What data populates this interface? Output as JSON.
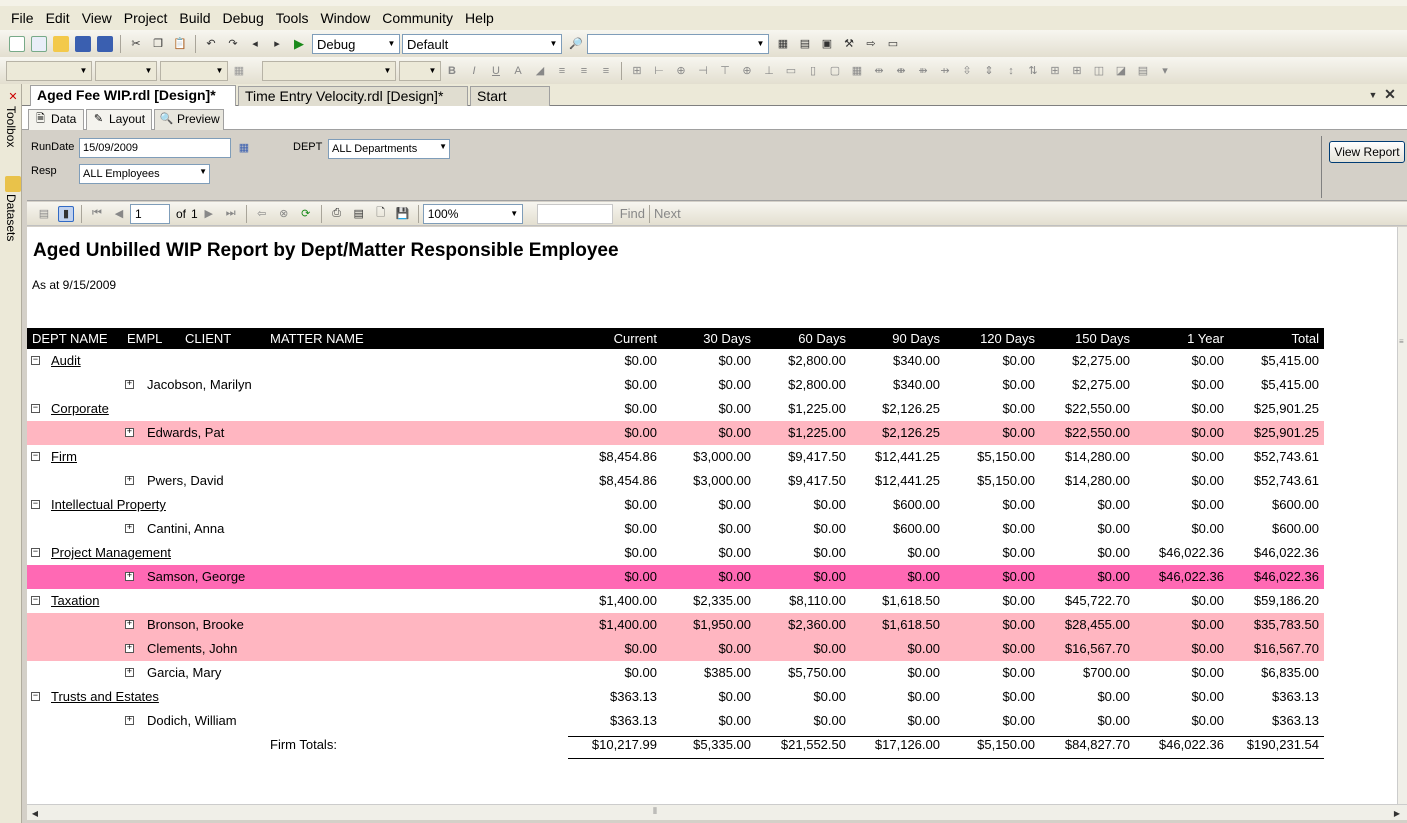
{
  "menu": [
    "File",
    "Edit",
    "View",
    "Project",
    "Build",
    "Debug",
    "Tools",
    "Window",
    "Community",
    "Help"
  ],
  "toolbar": {
    "config": "Debug",
    "platform": "Default"
  },
  "side_tabs": {
    "toolbox": "Toolbox",
    "datasets": "Datasets"
  },
  "doc_tabs": [
    "Aged Fee WIP.rdl [Design]*",
    "Time Entry Velocity.rdl [Design]*",
    "Start Page"
  ],
  "view_tabs": [
    "Data",
    "Layout",
    "Preview"
  ],
  "params": {
    "rundate_label": "RunDate",
    "rundate_value": "15/09/2009",
    "dept_label": "DEPT",
    "dept_value": "ALL Departments",
    "resp_label": "Resp",
    "resp_value": "ALL Employees",
    "view_button": "View Report"
  },
  "report_toolbar": {
    "page": "1",
    "of_label": "of",
    "total_pages": "1",
    "zoom": "100%",
    "find": "Find",
    "next": "Next"
  },
  "report": {
    "title": "Aged Unbilled WIP Report by Dept/Matter Responsible Employee",
    "subtitle": "As at 9/15/2009",
    "columns": [
      "DEPT NAME",
      "EMPL",
      "CLIENT",
      "MATTER NAME",
      "Current",
      "30 Days",
      "60 Days",
      "90 Days",
      "120 Days",
      "150 Days",
      "1 Year",
      "Total"
    ],
    "rows": [
      {
        "kind": "dept",
        "name": "Audit",
        "values": [
          "$0.00",
          "$0.00",
          "$2,800.00",
          "$340.00",
          "$0.00",
          "$2,275.00",
          "$0.00",
          "$5,415.00"
        ],
        "bg": "#ffffff"
      },
      {
        "kind": "emp",
        "name": "Jacobson, Marilyn",
        "values": [
          "$0.00",
          "$0.00",
          "$2,800.00",
          "$340.00",
          "$0.00",
          "$2,275.00",
          "$0.00",
          "$5,415.00"
        ],
        "bg": "#ffffff"
      },
      {
        "kind": "dept",
        "name": "Corporate",
        "values": [
          "$0.00",
          "$0.00",
          "$1,225.00",
          "$2,126.25",
          "$0.00",
          "$22,550.00",
          "$0.00",
          "$25,901.25"
        ],
        "bg": "#ffffff"
      },
      {
        "kind": "emp",
        "name": "Edwards, Pat",
        "values": [
          "$0.00",
          "$0.00",
          "$1,225.00",
          "$2,126.25",
          "$0.00",
          "$22,550.00",
          "$0.00",
          "$25,901.25"
        ],
        "bg": "#ffb6c1"
      },
      {
        "kind": "dept",
        "name": "Firm",
        "values": [
          "$8,454.86",
          "$3,000.00",
          "$9,417.50",
          "$12,441.25",
          "$5,150.00",
          "$14,280.00",
          "$0.00",
          "$52,743.61"
        ],
        "bg": "#ffffff"
      },
      {
        "kind": "emp",
        "name": "Pwers, David",
        "values": [
          "$8,454.86",
          "$3,000.00",
          "$9,417.50",
          "$12,441.25",
          "$5,150.00",
          "$14,280.00",
          "$0.00",
          "$52,743.61"
        ],
        "bg": "#ffffff"
      },
      {
        "kind": "dept",
        "name": "Intellectual Property",
        "values": [
          "$0.00",
          "$0.00",
          "$0.00",
          "$600.00",
          "$0.00",
          "$0.00",
          "$0.00",
          "$600.00"
        ],
        "bg": "#ffffff"
      },
      {
        "kind": "emp",
        "name": "Cantini, Anna",
        "values": [
          "$0.00",
          "$0.00",
          "$0.00",
          "$600.00",
          "$0.00",
          "$0.00",
          "$0.00",
          "$600.00"
        ],
        "bg": "#ffffff"
      },
      {
        "kind": "dept",
        "name": "Project Management",
        "values": [
          "$0.00",
          "$0.00",
          "$0.00",
          "$0.00",
          "$0.00",
          "$0.00",
          "$46,022.36",
          "$46,022.36"
        ],
        "bg": "#ffffff"
      },
      {
        "kind": "emp",
        "name": "Samson, George",
        "values": [
          "$0.00",
          "$0.00",
          "$0.00",
          "$0.00",
          "$0.00",
          "$0.00",
          "$46,022.36",
          "$46,022.36"
        ],
        "bg": "#ff69b4"
      },
      {
        "kind": "dept",
        "name": "Taxation",
        "values": [
          "$1,400.00",
          "$2,335.00",
          "$8,110.00",
          "$1,618.50",
          "$0.00",
          "$45,722.70",
          "$0.00",
          "$59,186.20"
        ],
        "bg": "#ffffff"
      },
      {
        "kind": "emp",
        "name": "Bronson, Brooke",
        "values": [
          "$1,400.00",
          "$1,950.00",
          "$2,360.00",
          "$1,618.50",
          "$0.00",
          "$28,455.00",
          "$0.00",
          "$35,783.50"
        ],
        "bg": "#ffb6c1"
      },
      {
        "kind": "emp",
        "name": "Clements, John",
        "values": [
          "$0.00",
          "$0.00",
          "$0.00",
          "$0.00",
          "$0.00",
          "$16,567.70",
          "$0.00",
          "$16,567.70"
        ],
        "bg": "#ffb6c1"
      },
      {
        "kind": "emp",
        "name": "Garcia, Mary",
        "values": [
          "$0.00",
          "$385.00",
          "$5,750.00",
          "$0.00",
          "$0.00",
          "$700.00",
          "$0.00",
          "$6,835.00"
        ],
        "bg": "#ffffff"
      },
      {
        "kind": "dept",
        "name": "Trusts and Estates",
        "values": [
          "$363.13",
          "$0.00",
          "$0.00",
          "$0.00",
          "$0.00",
          "$0.00",
          "$0.00",
          "$363.13"
        ],
        "bg": "#ffffff"
      },
      {
        "kind": "emp",
        "name": "Dodich, William",
        "values": [
          "$363.13",
          "$0.00",
          "$0.00",
          "$0.00",
          "$0.00",
          "$0.00",
          "$0.00",
          "$363.13"
        ],
        "bg": "#ffffff"
      }
    ],
    "totals": {
      "label": "Firm Totals:",
      "values": [
        "$10,217.99",
        "$5,335.00",
        "$21,552.50",
        "$17,126.00",
        "$5,150.00",
        "$84,827.70",
        "$46,022.36",
        "$190,231.54"
      ]
    }
  }
}
